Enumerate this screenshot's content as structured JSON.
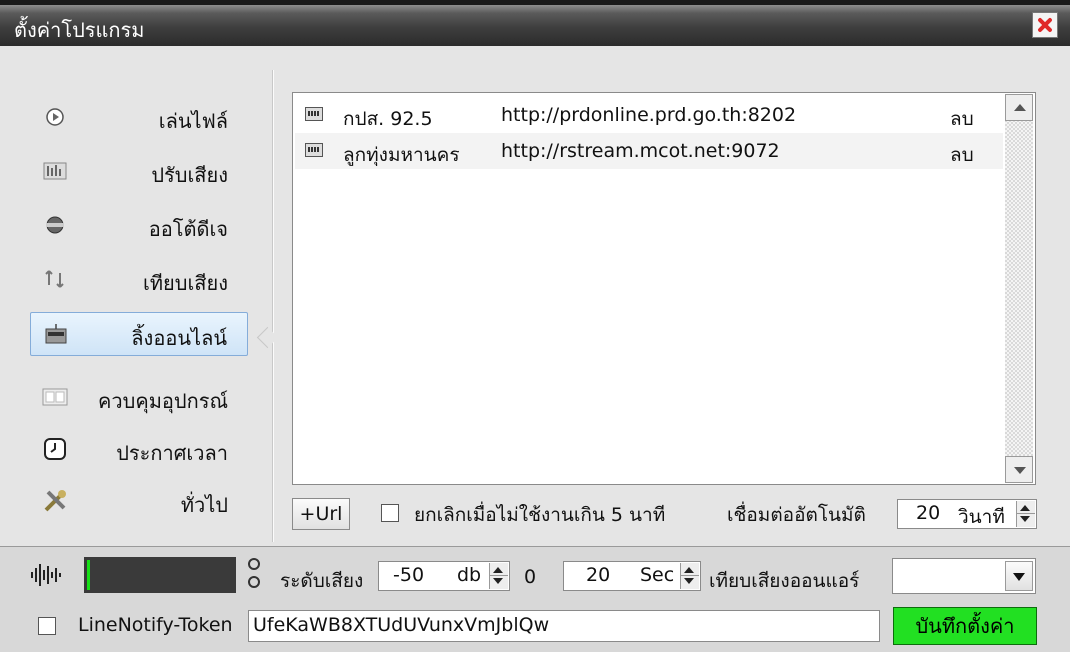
{
  "window": {
    "title": "ตั้งค่าโปรแกรม"
  },
  "sidebar": {
    "items": [
      {
        "label": "เล่นไฟล์",
        "icon": "play-file-icon"
      },
      {
        "label": "ปรับเสียง",
        "icon": "equalizer-icon"
      },
      {
        "label": "ออโต้ดีเจ",
        "icon": "auto-dj-icon"
      },
      {
        "label": "เทียบเสียง",
        "icon": "sync-audio-icon"
      },
      {
        "label": "ลิ้งออนไลน์",
        "icon": "online-link-icon",
        "selected": true
      },
      {
        "label": "ควบคุมอุปกรณ์",
        "icon": "device-control-icon"
      },
      {
        "label": "ประกาศเวลา",
        "icon": "clock-icon"
      },
      {
        "label": "ทั่วไป",
        "icon": "tools-icon"
      }
    ]
  },
  "streams": {
    "rows": [
      {
        "name": "กปส. 92.5",
        "url": "http://prdonline.prd.go.th:8202",
        "action": "ลบ"
      },
      {
        "name": "ลูกทุ่งมหานคร",
        "url": "http://rstream.mcot.net:9072",
        "action": "ลบ"
      }
    ],
    "add_button": "+Url",
    "idle_cancel_label": "ยกเลิกเมื่อไม่ใช้งานเกิน 5 นาที",
    "auto_reconnect_label": "เชื่อมต่ออัตโนมัติ",
    "auto_reconnect_value": "20",
    "auto_reconnect_unit": "วินาที"
  },
  "footer": {
    "meter_level": 0.02,
    "level_label": "ระดับเสียง",
    "level_value": "-50",
    "level_unit": "db",
    "level_readout": "0",
    "sec_value": "20",
    "sec_unit": "Sec",
    "air_sync_label": "เทียบเสียงออนแอร์",
    "air_sync_selected": "",
    "token_label": "LineNotify-Token",
    "token_value": "UfeKaWB8XTUdUVunxVmJblQw",
    "save_button": "บันทึกตั้งค่า"
  },
  "colors": {
    "accent": "#22e022",
    "meter": "#18e018",
    "close": "#e02828"
  }
}
